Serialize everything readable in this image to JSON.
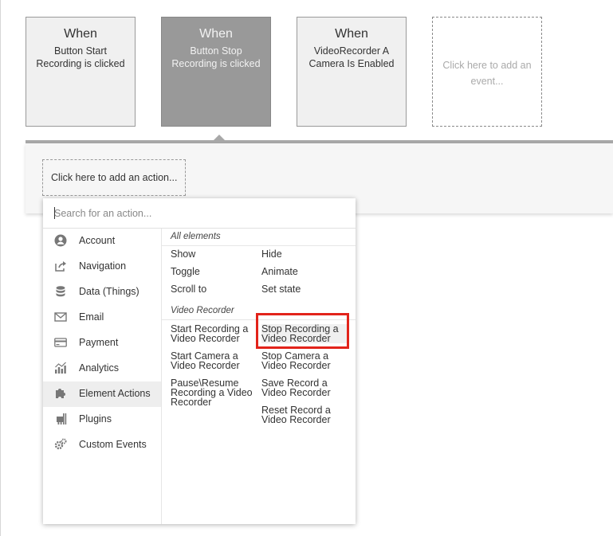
{
  "events": [
    {
      "title": "When",
      "desc": "Button Start Recording is clicked"
    },
    {
      "title": "When",
      "desc": "Button Stop Recording is clicked"
    },
    {
      "title": "When",
      "desc": "VideoRecorder A Camera Is Enabled"
    }
  ],
  "add_event": "Click here to add an event...",
  "add_action": "Click here to add an action...",
  "search": {
    "placeholder": "Search for an action..."
  },
  "categories": [
    {
      "label": "Account",
      "icon": "user-icon"
    },
    {
      "label": "Navigation",
      "icon": "share-icon"
    },
    {
      "label": "Data (Things)",
      "icon": "database-icon"
    },
    {
      "label": "Email",
      "icon": "envelope-icon"
    },
    {
      "label": "Payment",
      "icon": "credit-card-icon"
    },
    {
      "label": "Analytics",
      "icon": "chart-icon"
    },
    {
      "label": "Element Actions",
      "icon": "puzzle-icon"
    },
    {
      "label": "Plugins",
      "icon": "plug-icon"
    },
    {
      "label": "Custom Events",
      "icon": "gears-icon"
    }
  ],
  "all_elements": {
    "header": "All elements",
    "actions": [
      "Show",
      "Hide",
      "Toggle",
      "Animate",
      "Scroll to",
      "Set state"
    ]
  },
  "video_recorder": {
    "header": "Video Recorder",
    "actions": [
      "Start Recording a Video Recorder",
      "Stop Recording a Video Recorder",
      "Start Camera a Video Recorder",
      "Stop Camera a Video Recorder",
      "Pause\\Resume Recording a Video Recorder",
      "Save Record a Video Recorder",
      "Reset Record a Video Recorder"
    ]
  }
}
